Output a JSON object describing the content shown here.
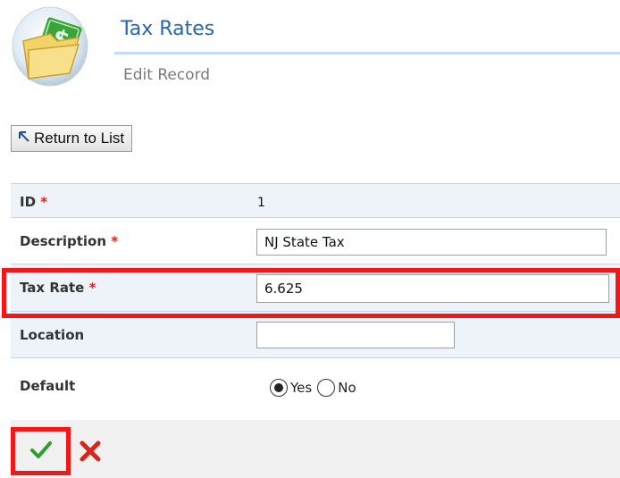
{
  "header": {
    "title": "Tax Rates",
    "subtitle": "Edit Record",
    "logo_icon": "money-folder-icon"
  },
  "toolbar": {
    "return_label": "Return to List",
    "return_icon": "arrow-up-left-icon"
  },
  "form": {
    "required_marker": "*",
    "fields": {
      "id": {
        "label": "ID",
        "value": "1"
      },
      "description": {
        "label": "Description",
        "value": "NJ State Tax"
      },
      "tax_rate": {
        "label": "Tax Rate",
        "value": "6.625"
      },
      "location": {
        "label": "Location",
        "value": ""
      },
      "default": {
        "label": "Default",
        "options": [
          "Yes",
          "No"
        ],
        "selected": "Yes"
      }
    }
  },
  "actions": {
    "save_icon": "checkmark-icon",
    "cancel_icon": "x-icon"
  },
  "colors": {
    "title": "#2b67a8",
    "highlight": "#f01818",
    "required": "#e02020",
    "save": "#2e9e2e",
    "cancel": "#d8261c"
  }
}
